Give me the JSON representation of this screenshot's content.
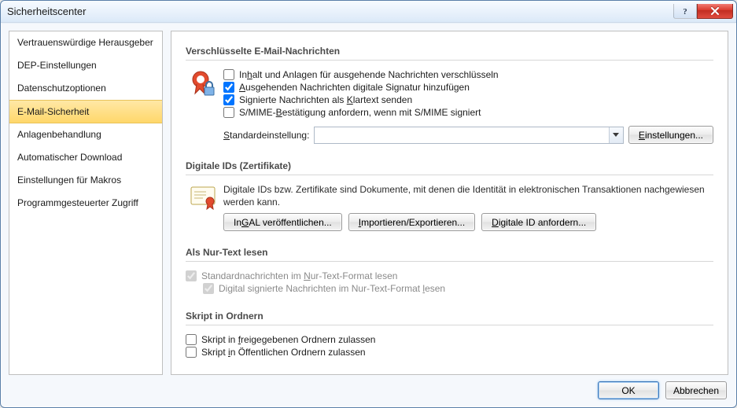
{
  "window": {
    "title": "Sicherheitscenter"
  },
  "nav": {
    "items": [
      {
        "label": "Vertrauenswürdige Herausgeber"
      },
      {
        "label": "DEP-Einstellungen"
      },
      {
        "label": "Datenschutzoptionen"
      },
      {
        "label": "E-Mail-Sicherheit"
      },
      {
        "label": "Anlagenbehandlung"
      },
      {
        "label": "Automatischer Download"
      },
      {
        "label": "Einstellungen für Makros"
      },
      {
        "label": "Programmgesteuerter Zugriff"
      }
    ],
    "selected_index": 3
  },
  "sections": {
    "encrypt": {
      "header": "Verschlüsselte E-Mail-Nachrichten",
      "options": {
        "encrypt_out": {
          "label_pre": "In",
          "label_u": "h",
          "label_post": "alt und Anlagen für ausgehende Nachrichten verschlüsseln",
          "checked": false
        },
        "sign_out": {
          "label_pre": "",
          "label_u": "A",
          "label_post": "usgehenden Nachrichten digitale Signatur hinzufügen",
          "checked": true
        },
        "signed_clear": {
          "label_pre": "Signierte Nachrichten als ",
          "label_u": "K",
          "label_post": "lartext senden",
          "checked": true
        },
        "smime_req": {
          "label_pre": "S/MIME-",
          "label_u": "B",
          "label_post": "estätigung anfordern, wenn mit S/MIME signiert",
          "checked": false
        }
      },
      "default_label_pre": "",
      "default_label_u": "S",
      "default_label_post": "tandardeinstellung:",
      "default_value": "",
      "settings_button_pre": "",
      "settings_button_u": "E",
      "settings_button_post": "instellungen..."
    },
    "digitalids": {
      "header": "Digitale IDs (Zertifikate)",
      "description": "Digitale IDs bzw. Zertifikate sind Dokumente, mit denen die Identität in elektronischen Transaktionen nachgewiesen werden kann.",
      "btn_gal_pre": "In ",
      "btn_gal_u": "G",
      "btn_gal_post": "AL veröffentlichen...",
      "btn_import_pre": "",
      "btn_import_u": "I",
      "btn_import_post": "mportieren/Exportieren...",
      "btn_request_pre": "",
      "btn_request_u": "D",
      "btn_request_post": "igitale ID anfordern..."
    },
    "plaintext": {
      "header": "Als Nur-Text lesen",
      "opt1_pre": "Standardnachrichten im ",
      "opt1_u": "N",
      "opt1_post": "ur-Text-Format lesen",
      "opt1_checked": true,
      "opt2_pre": "Digital signierte Nachrichten im Nur-Text-Format ",
      "opt2_u": "l",
      "opt2_post": "esen",
      "opt2_checked": true
    },
    "script": {
      "header": "Skript in Ordnern",
      "opt1_pre": "Skript in ",
      "opt1_u": "f",
      "opt1_post": "reigegebenen Ordnern zulassen",
      "opt1_checked": false,
      "opt2_pre": "Skript ",
      "opt2_u": "i",
      "opt2_post": "n Öffentlichen Ordnern zulassen",
      "opt2_checked": false
    }
  },
  "footer": {
    "ok": "OK",
    "cancel": "Abbrechen"
  }
}
